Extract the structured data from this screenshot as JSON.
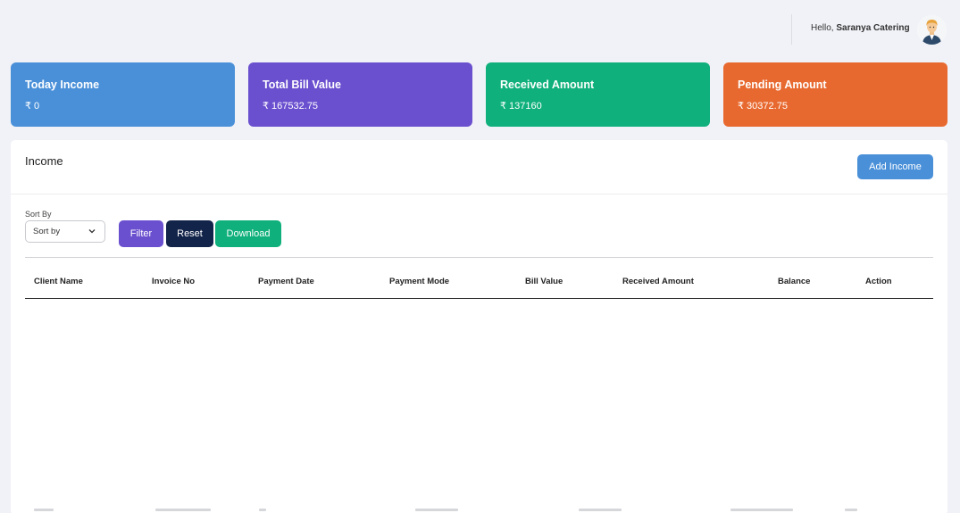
{
  "header": {
    "greeting_prefix": "Hello,",
    "user_name": "Saranya Catering",
    "avatar_icon": "user-avatar-icon"
  },
  "cards": [
    {
      "title": "Today Income",
      "value": "₹ 0",
      "color": "#4a90d9"
    },
    {
      "title": "Total Bill Value",
      "value": "₹ 167532.75",
      "color": "#6a4fcf"
    },
    {
      "title": "Received Amount",
      "value": "₹ 137160",
      "color": "#0fb07b"
    },
    {
      "title": "Pending Amount",
      "value": "₹ 30372.75",
      "color": "#e8692f"
    }
  ],
  "panel": {
    "title": "Income",
    "add_button": "Add Income",
    "sort_label": "Sort By",
    "sort_value": "Sort by",
    "filter_button": "Filter",
    "reset_button": "Reset",
    "download_button": "Download"
  },
  "table": {
    "columns": [
      "Client Name",
      "Invoice No",
      "Payment Date",
      "Payment Mode",
      "Bill Value",
      "Received Amount",
      "Balance",
      "Action"
    ]
  }
}
